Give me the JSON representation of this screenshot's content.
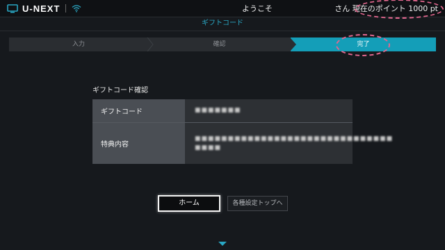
{
  "header": {
    "logo_text": "U-NEXT",
    "welcome": "ようこそ",
    "points_text": "さん 現在のポイント 1000 pt"
  },
  "subtitle": "ギフトコード",
  "steps": [
    {
      "label": "入力",
      "state": "done"
    },
    {
      "label": "確認",
      "state": "done"
    },
    {
      "label": "完了",
      "state": "current"
    }
  ],
  "section_title": "ギフトコード確認",
  "table": {
    "rows": [
      {
        "label": "ギフトコード",
        "value": "■■■■■■■"
      },
      {
        "label": "特典内容",
        "value": "■■■■■■■■■■■■■■■■■■■■■■■■■■■■■■ ■■■■"
      }
    ]
  },
  "buttons": {
    "home": "ホーム",
    "settings_top": "各種設定トップへ"
  },
  "colors": {
    "accent": "#149eb8",
    "subtitle": "#29a7c4",
    "annotation": "#e4678f",
    "background": "#16191d"
  },
  "icons": {
    "logo": "tv-icon",
    "network": "wifi-icon",
    "scroll": "chevron-down-icon"
  }
}
